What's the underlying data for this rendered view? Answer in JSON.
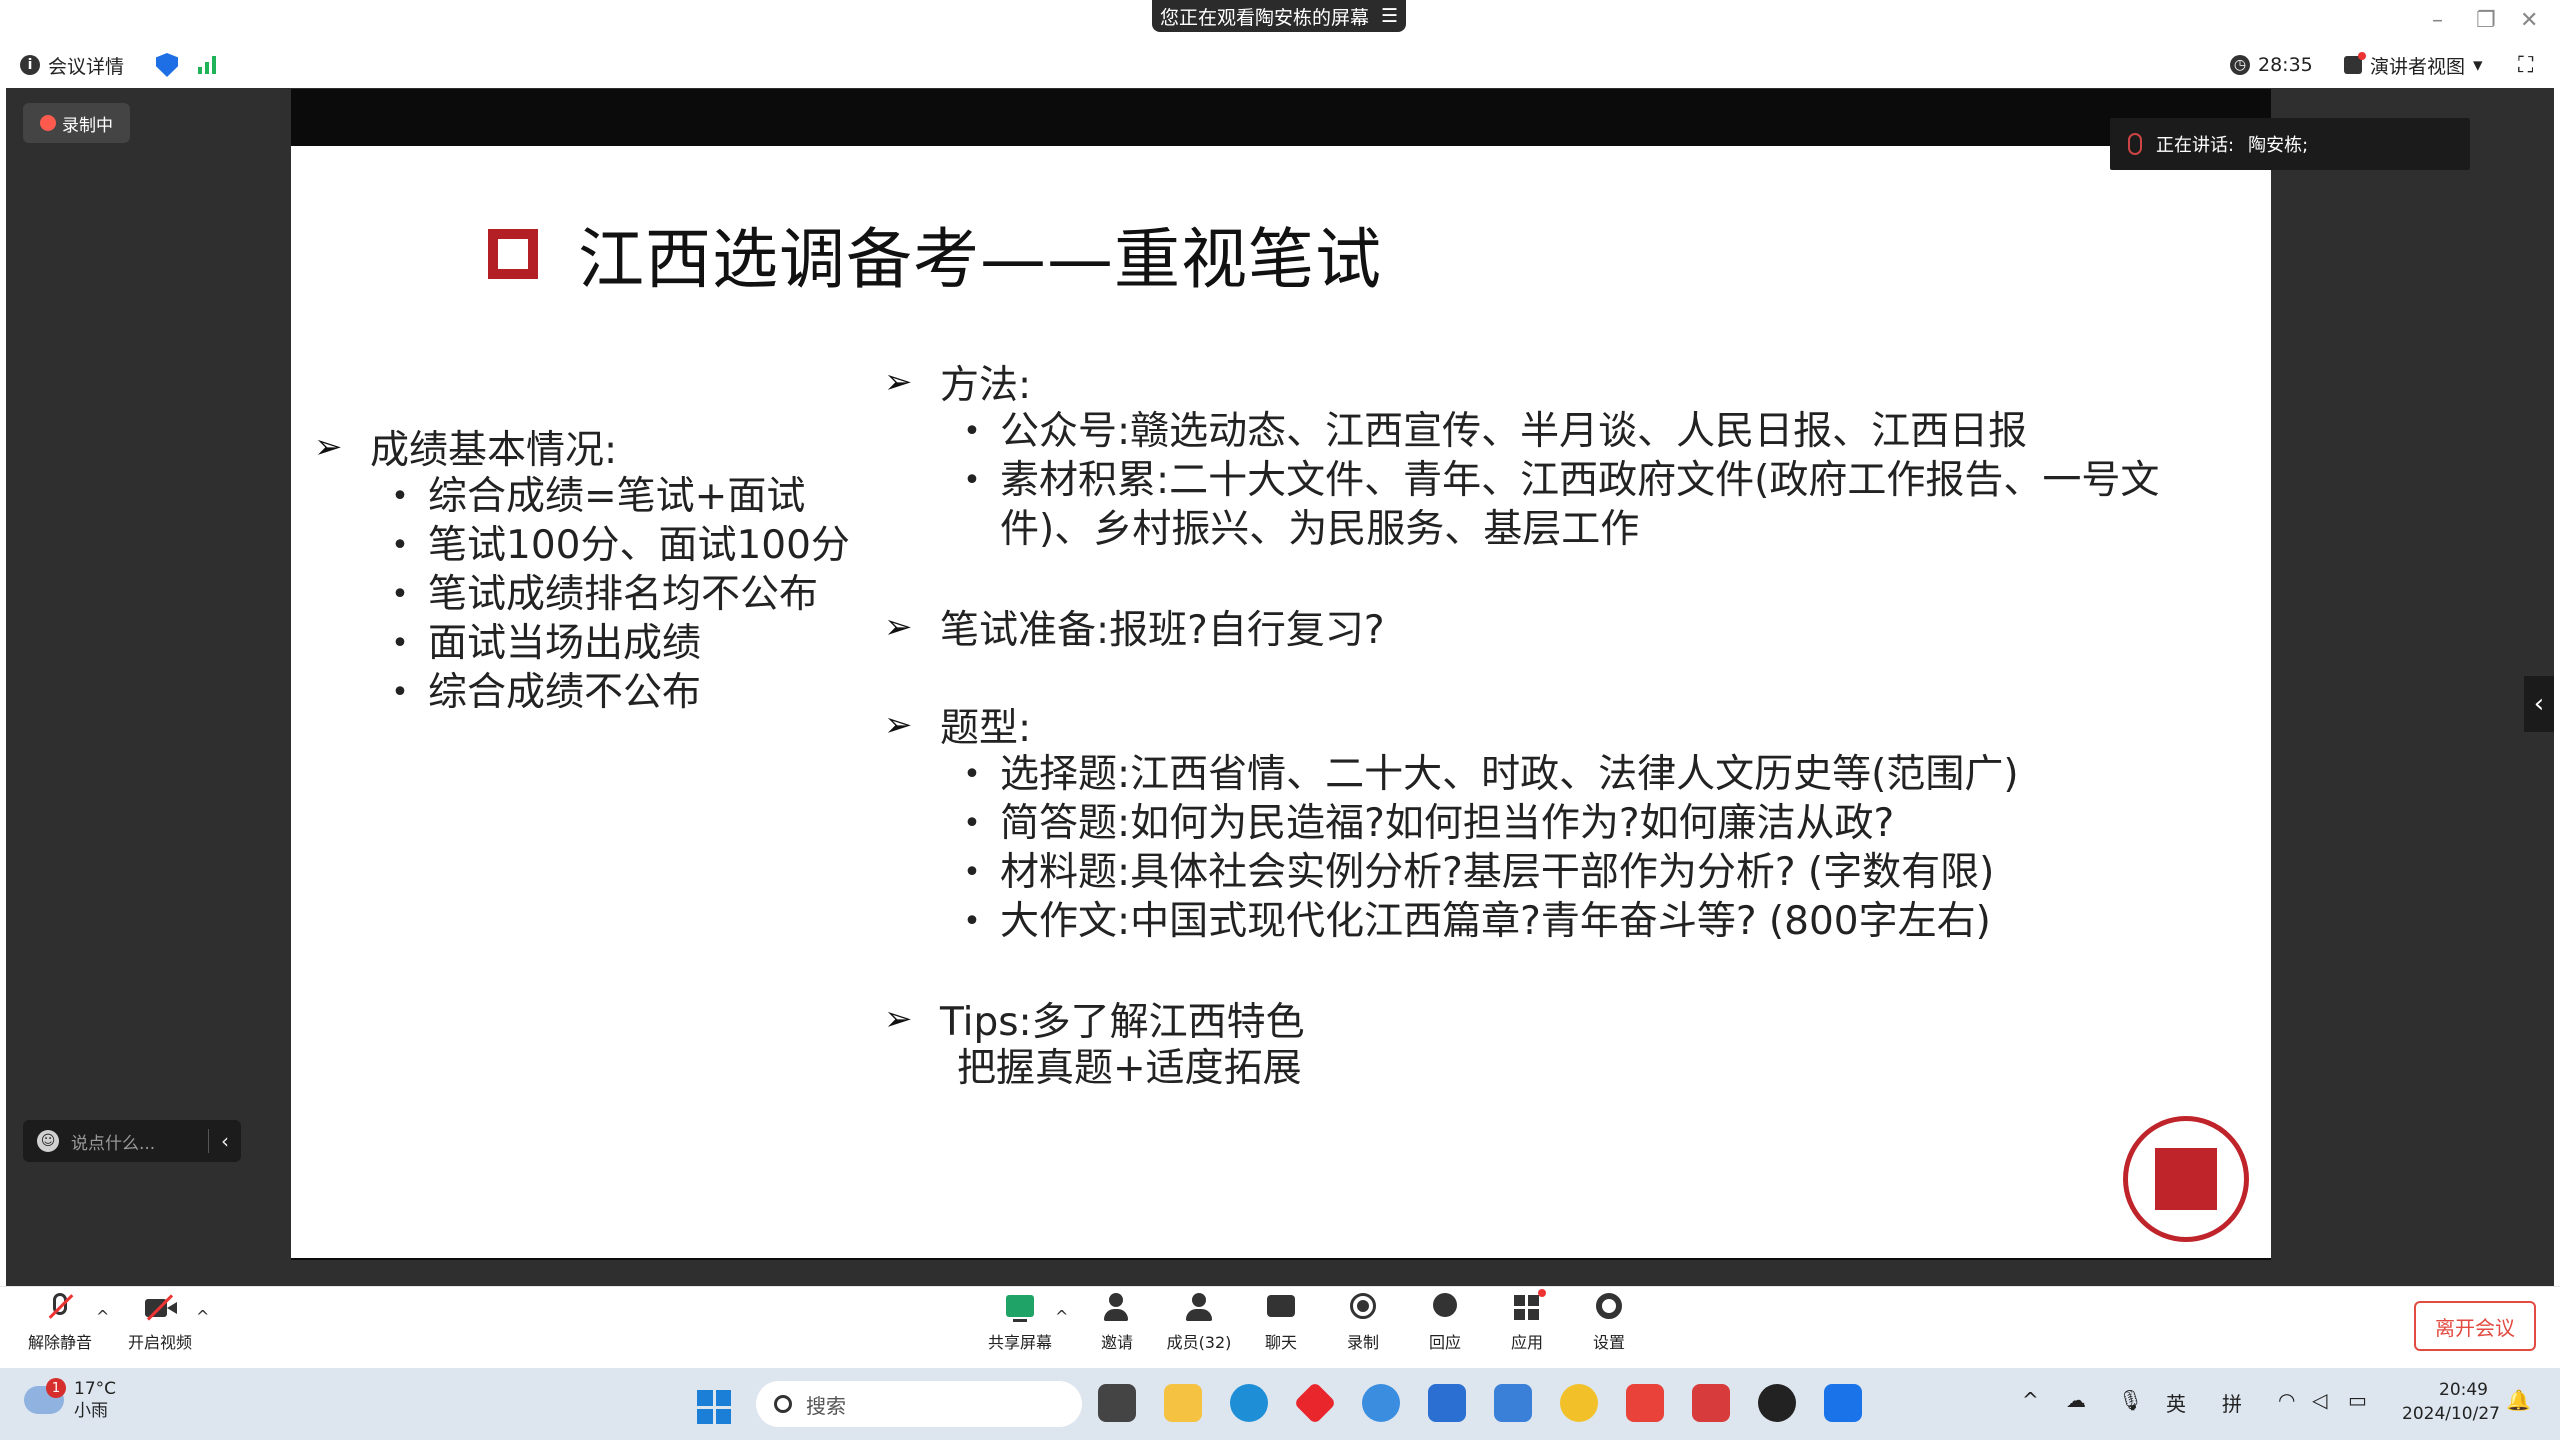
{
  "window": {
    "share_banner": "您正在观看陶安栋的屏幕",
    "minimize": "–",
    "restore": "❐",
    "close": "✕"
  },
  "topbar": {
    "meeting_info": "会议详情",
    "timer": "28:35",
    "view_mode": "演讲者视图"
  },
  "stage": {
    "recording_label": "录制中",
    "speaking_label": "正在讲话:",
    "speaker_name": "陶安栋;",
    "chat_placeholder": "说点什么..."
  },
  "slide": {
    "title": "江西选调备考——重视笔试",
    "left": {
      "heading": "成绩基本情况:",
      "items": [
        "综合成绩=笔试+面试",
        "笔试100分、面试100分",
        "笔试成绩排名均不公布",
        "面试当场出成绩",
        "综合成绩不公布"
      ]
    },
    "method": {
      "heading": "方法:",
      "items": [
        "公众号:赣选动态、江西宣传、半月谈、人民日报、江西日报",
        "素材积累:二十大文件、青年、江西政府文件(政府工作报告、一号文件)、乡村振兴、为民服务、基层工作"
      ]
    },
    "prep": {
      "heading": "笔试准备:报班?自行复习?"
    },
    "types": {
      "heading": "题型:",
      "items": [
        "选择题:江西省情、二十大、时政、法律人文历史等(范围广)",
        "简答题:如何为民造福?如何担当作为?如何廉洁从政?",
        "材料题:具体社会实例分析?基层干部作为分析? (字数有限)",
        "大作文:中国式现代化江西篇章?青年奋斗等? (800字左右)"
      ]
    },
    "tips": {
      "heading": "Tips:多了解江西特色",
      "sub": "把握真题+适度拓展"
    },
    "bullet_symbol": "•",
    "arrow_symbol": "➢"
  },
  "toolbar": {
    "unmute": "解除静音",
    "start_video": "开启视频",
    "share_screen": "共享屏幕",
    "invite": "邀请",
    "members": "成员(32)",
    "chat": "聊天",
    "record": "录制",
    "reactions": "回应",
    "apps": "应用",
    "settings": "设置",
    "leave": "离开会议"
  },
  "taskbar": {
    "temperature": "17°C",
    "weather": "小雨",
    "weather_badge": "1",
    "search_placeholder": "搜索",
    "lang_en": "英",
    "lang_pinyin": "拼",
    "time": "20:49",
    "date": "2024/10/27"
  },
  "colors": {
    "slide_title_square": "#b41e25",
    "stage_background": "#2f2f2f",
    "leave_button": "#e24b41",
    "taskbar_background": "#dde6ef"
  }
}
